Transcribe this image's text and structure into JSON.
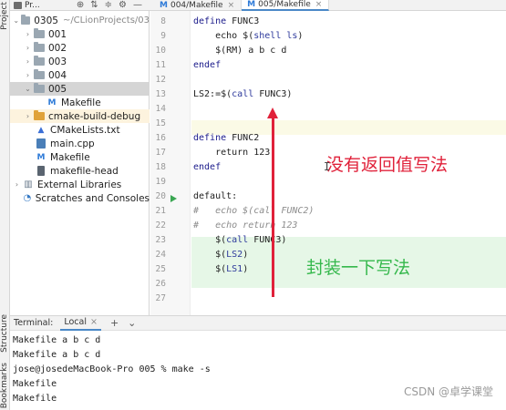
{
  "side_strip": {
    "top_label": "Project",
    "mid_label": "Structure",
    "bottom_label": "Bookmarks"
  },
  "project_header": {
    "title": "Pr...",
    "icons": [
      "target-icon",
      "collapse-icon",
      "expand-icon",
      "gear-icon",
      "minimize-icon"
    ]
  },
  "tabs": [
    {
      "label": "004/Makefile",
      "close": "×",
      "icon": "M"
    },
    {
      "label": "005/Makefile",
      "close": "×",
      "icon": "M"
    }
  ],
  "tree": [
    {
      "arrow": "⌄",
      "type": "folder",
      "label": "0305",
      "path": "~/CLionProjects/03"
    },
    {
      "arrow": "›",
      "type": "folder",
      "label": "001"
    },
    {
      "arrow": "›",
      "type": "folder",
      "label": "002"
    },
    {
      "arrow": "›",
      "type": "folder",
      "label": "003"
    },
    {
      "arrow": "›",
      "type": "folder",
      "label": "004"
    },
    {
      "arrow": "⌄",
      "type": "folder",
      "label": "005"
    },
    {
      "arrow": "",
      "type": "makefile",
      "label": "Makefile"
    },
    {
      "arrow": "›",
      "type": "folder-orange",
      "label": "cmake-build-debug"
    },
    {
      "arrow": "",
      "type": "cmake",
      "label": "CMakeLists.txt"
    },
    {
      "arrow": "",
      "type": "cpp",
      "label": "main.cpp"
    },
    {
      "arrow": "",
      "type": "makefile",
      "label": "Makefile"
    },
    {
      "arrow": "",
      "type": "doc",
      "label": "makefile-head"
    },
    {
      "arrow": "›",
      "type": "lib",
      "label": "External Libraries"
    },
    {
      "arrow": "",
      "type": "scratch",
      "label": "Scratches and Consoles"
    }
  ],
  "line_numbers": [
    "8",
    "9",
    "10",
    "11",
    "12",
    "13",
    "14",
    "15",
    "16",
    "17",
    "18",
    "19",
    "20",
    "21",
    "22",
    "23",
    "24",
    "25",
    "26",
    "27"
  ],
  "code": [
    {
      "kw": "define",
      "rest": " FUNC3"
    },
    {
      "text": "    echo $(",
      "pp": "shell",
      "mid": " ",
      "pp2": "ls",
      "end": ")"
    },
    {
      "text": "    $(RM) a b c d"
    },
    {
      "kw": "endef"
    },
    {
      "text": ""
    },
    {
      "text": "LS2:=$(",
      "pp": "call",
      "mid": " FUNC3)"
    },
    {
      "text": ""
    },
    {
      "text": ""
    },
    {
      "kw": "define",
      "rest": " FUNC2"
    },
    {
      "text": "    return 123"
    },
    {
      "kw": "endef"
    },
    {
      "text": ""
    },
    {
      "text": "default:"
    },
    {
      "comment": "#   echo $(call FUNC2)"
    },
    {
      "comment": "#   echo return 123"
    },
    {
      "text": "    $(",
      "pp": "call",
      "mid": " FUNC3)"
    },
    {
      "text": "    $(",
      "pp": "LS2",
      "end": ")"
    },
    {
      "text": "    $(",
      "pp": "LS1",
      "end": ")"
    },
    {
      "text": ""
    },
    {
      "text": ""
    }
  ],
  "annotations": {
    "no_return": "没有返回值写法",
    "wrap": "封装一下写法",
    "caret": "I"
  },
  "colors": {
    "arrow": "#e0213a",
    "green_text": "#35b84c"
  },
  "terminal": {
    "label": "Terminal:",
    "tab": "Local",
    "tab_close": "×",
    "add": "+",
    "chevron": "⌄",
    "lines": [
      "Makefile a b c d",
      "Makefile a b c d",
      "jose@josedeMacBook-Pro 005 % make -s",
      "Makefile",
      "Makefile"
    ]
  },
  "watermark": "CSDN @卓学课堂"
}
